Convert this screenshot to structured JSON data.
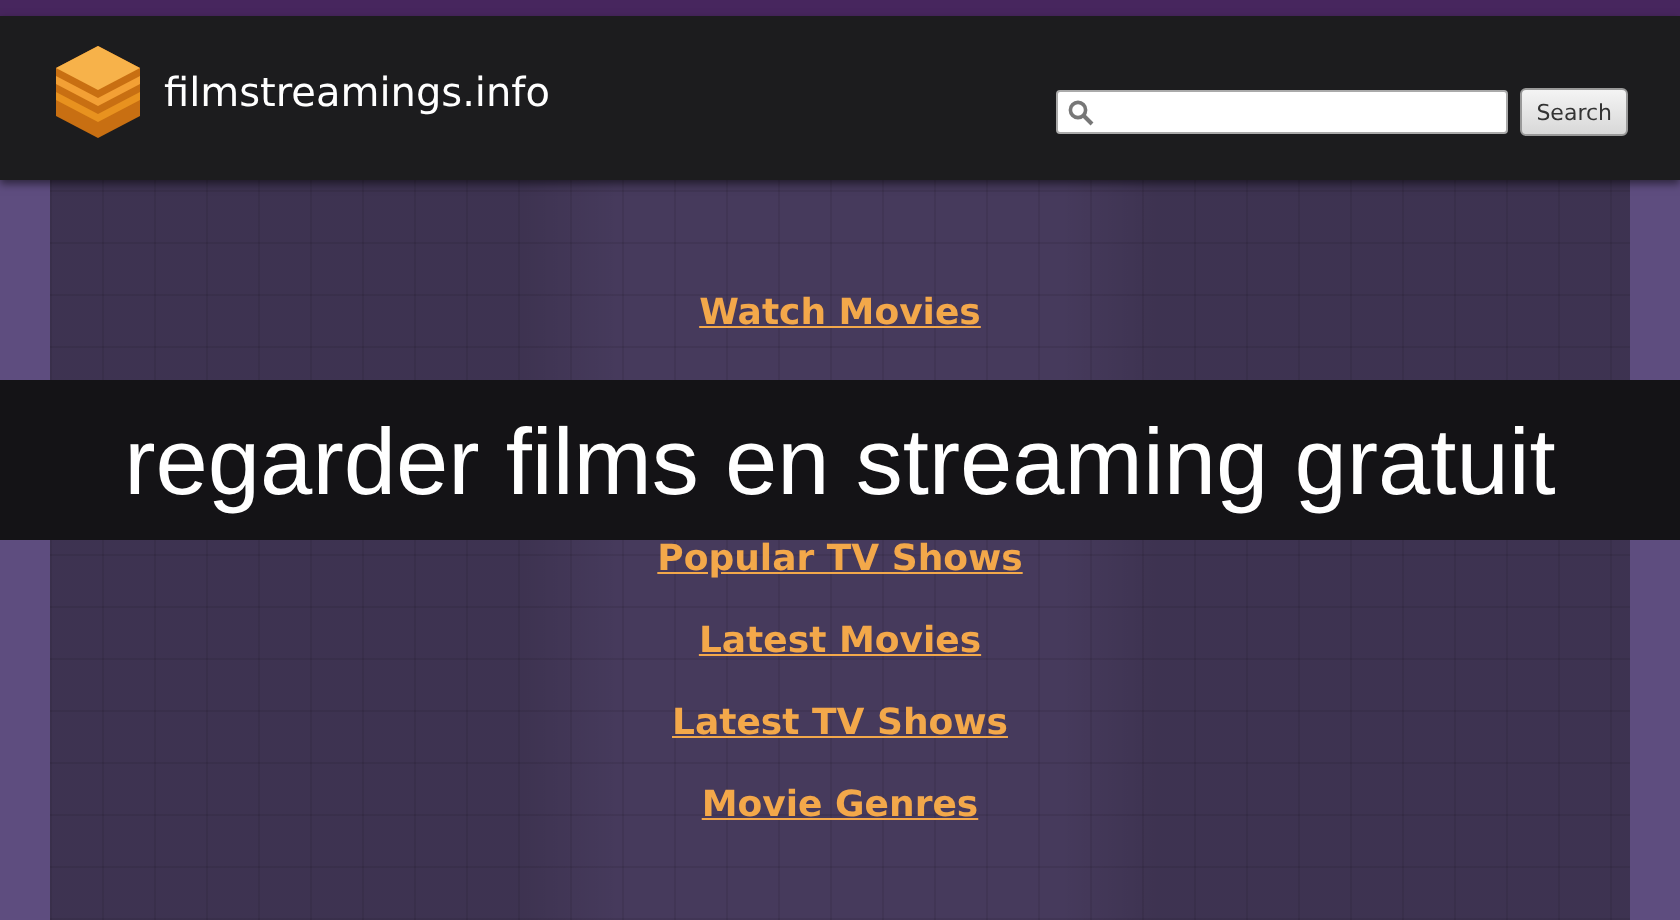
{
  "header": {
    "site_name": "filmstreamings.info",
    "search": {
      "button": "Search"
    }
  },
  "nav_links": [
    "Watch Movies",
    "Popular TV Shows",
    "Latest Movies",
    "Latest TV Shows",
    "Movie Genres"
  ],
  "banner": {
    "caption": "regarder films en streaming gratuit"
  }
}
